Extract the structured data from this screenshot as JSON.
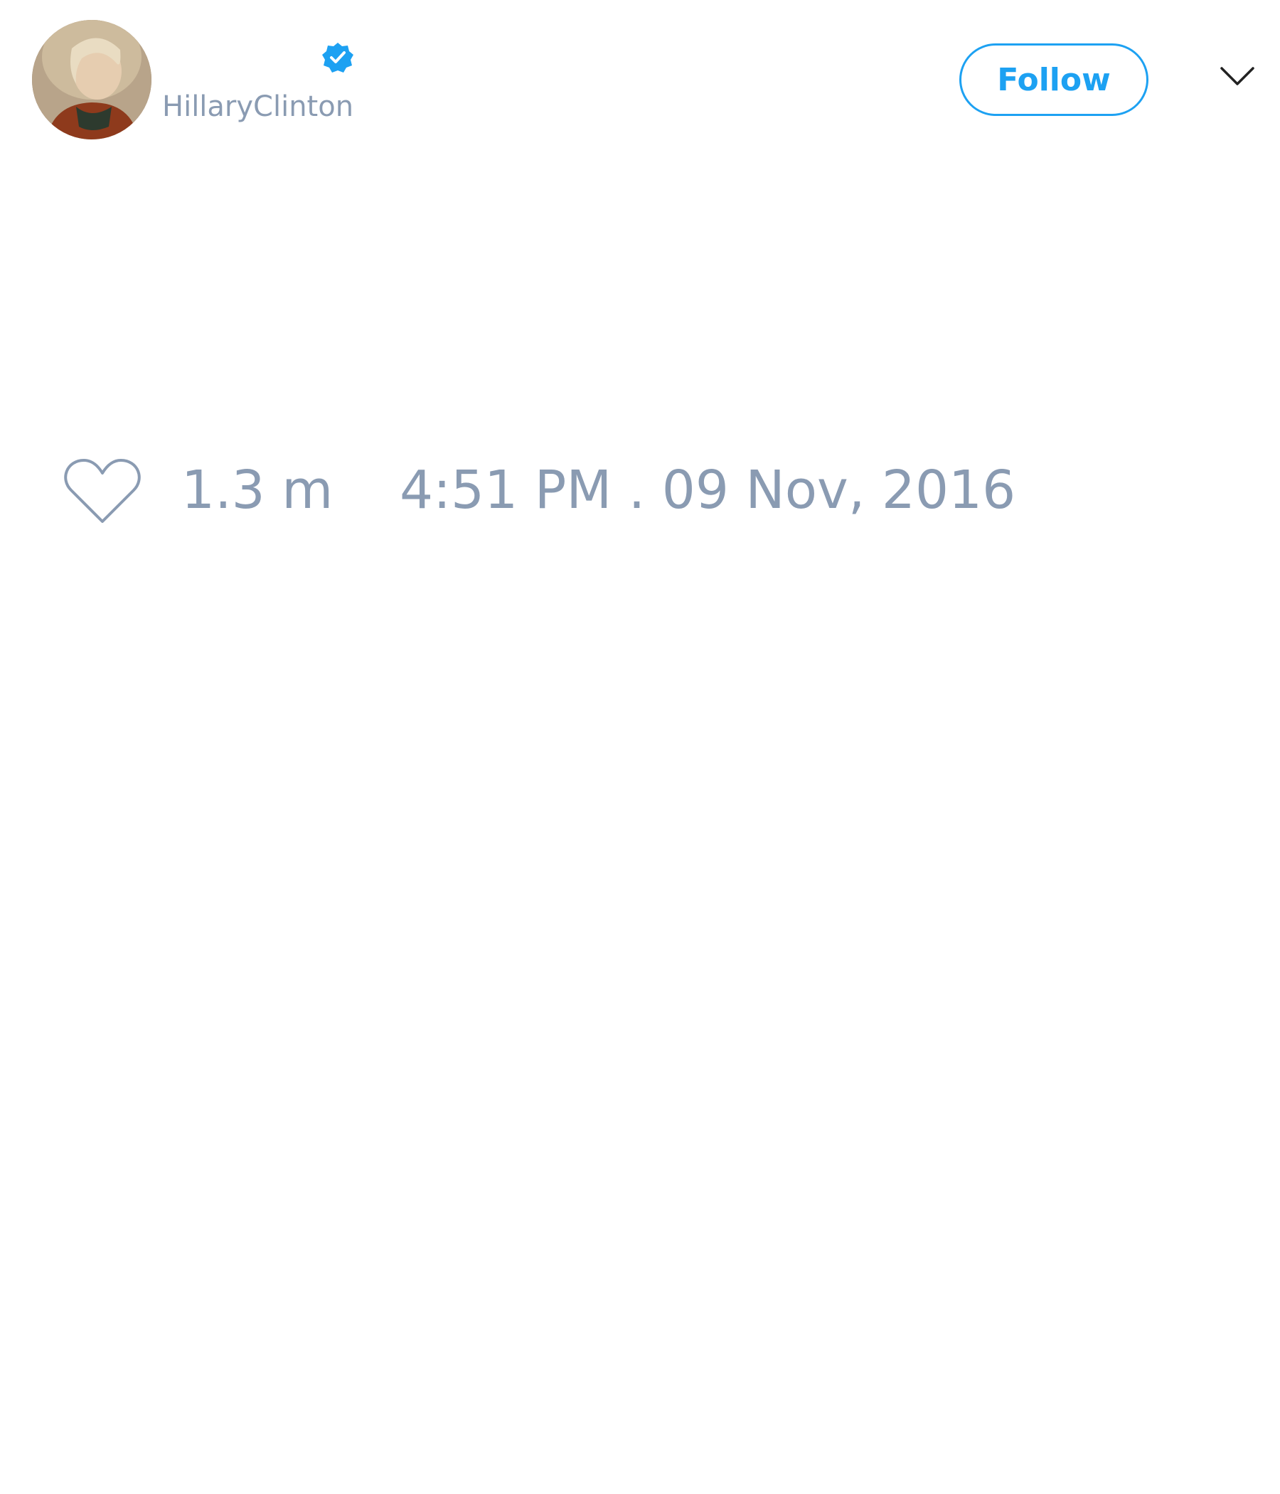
{
  "user": {
    "handle": "HillaryClinton",
    "verified": true,
    "verified_color": "#1da1f2"
  },
  "header": {
    "follow_label": "Follow",
    "menu_icon": "chevron-down-icon"
  },
  "tweet": {
    "like_icon": "heart-icon",
    "like_count": "1.3 m",
    "timestamp": "4:51 PM . 09 Nov, 2016"
  },
  "colors": {
    "accent": "#1da1f2",
    "muted_text": "#8a9bb2",
    "icon_stroke": "#8a9bb2",
    "background": "#ffffff"
  }
}
